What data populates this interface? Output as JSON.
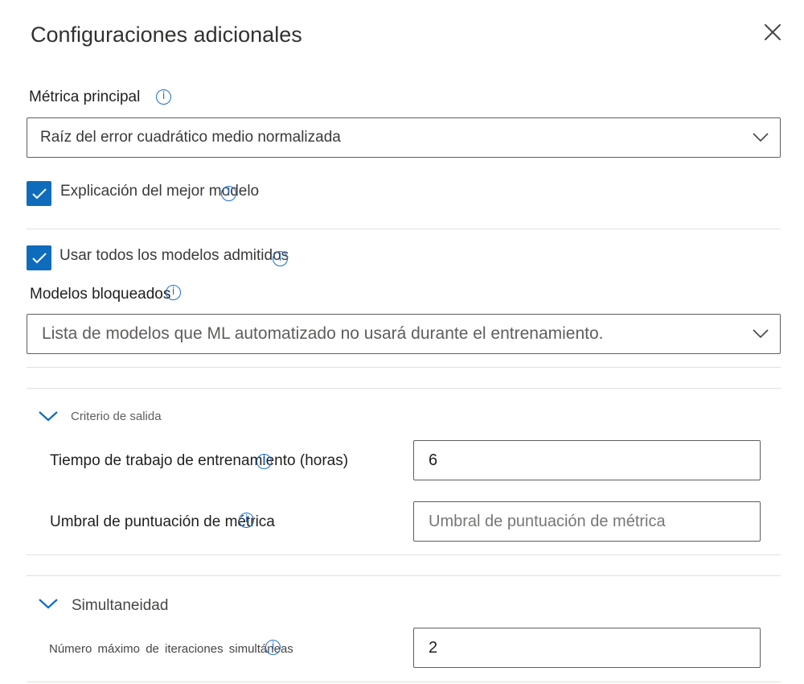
{
  "panel": {
    "title": "Configuraciones adicionales"
  },
  "primary_metric": {
    "label": "Métrica principal",
    "value": "Raíz del error cuadrático medio normalizada"
  },
  "explain_best": {
    "label": "Explicación del mejor modelo",
    "checked": true
  },
  "use_all_models": {
    "label": "Usar todos los modelos admitidos",
    "checked": true
  },
  "blocked_models": {
    "label": "Modelos bloqueados",
    "placeholder": "Lista de modelos que ML automatizado no usará durante el entrenamiento."
  },
  "exit_criterion": {
    "header": "Criterio de salida",
    "expanded": true,
    "training_time": {
      "label": "Tiempo de trabajo de entrenamiento (horas)",
      "value": "6"
    },
    "metric_threshold": {
      "label": "Umbral de puntuación de métrica",
      "value": "",
      "placeholder": "Umbral de puntuación de métrica"
    }
  },
  "concurrency": {
    "header": "Simultaneidad",
    "expanded": true,
    "max_iterations": {
      "label": "Número máximo de iteraciones simultáneas",
      "value": "2"
    }
  },
  "icons": {
    "info": "info-icon",
    "close": "close-icon",
    "chevron": "chevron-down-icon",
    "check": "checkmark-icon"
  },
  "colors": {
    "accent": "#0f6cbd",
    "info": "#1a6fd0",
    "border": "#605e5c",
    "divider": "#e1dfdd"
  }
}
